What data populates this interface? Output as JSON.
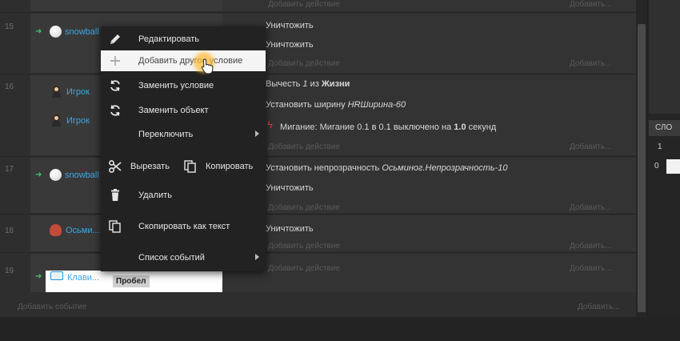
{
  "rows": [
    {
      "num": "15",
      "object": "snowball"
    },
    {
      "num": "16",
      "object": "Игрок",
      "object2": "Игрок"
    },
    {
      "num": "17",
      "object": "snowball"
    },
    {
      "num": "18",
      "object": "Осьми..."
    },
    {
      "num": "19",
      "object": "Клави...",
      "condition_value": "Пробел"
    }
  ],
  "actions": {
    "row15_a": "Уничтожить",
    "row15_b": "Уничтожить",
    "row16_a_pre": "Вычесть ",
    "row16_a_num": "1",
    "row16_a_mid": " из ",
    "row16_a_bold": "Жизни",
    "row16_b_pre": "Установить ширину ",
    "row16_b_val": "HRШирина-60",
    "row16_c_pre": "Мигание: Мигание 0.1 в 0.1 выключено на ",
    "row16_c_bold": "1.0",
    "row16_c_post": " секунд",
    "row17_a_pre": "Установить непрозрачность ",
    "row17_a_val": "Осьминог.Непрозрачность-10",
    "row17_b": "Уничтожить",
    "row18_a": "Уничтожить"
  },
  "add_action_label": "Добавить действие",
  "add_action_right_label": "Добавить...",
  "add_event_label": "Добавить событие",
  "context_menu": {
    "edit": "Редактировать",
    "add_condition": "Добавить другое условие",
    "replace_condition": "Заменить условие",
    "replace_object": "Заменить объект",
    "toggle": "Переключить",
    "cut": "Вырезать",
    "copy": "Копировать",
    "delete": "Удалить",
    "copy_as_text": "Скопировать как текст",
    "event_list": "Список событий"
  },
  "vars_panel": {
    "header": "СЛО",
    "row1": "1",
    "row0": "0"
  },
  "colors": {
    "object_link": "#3fa6e6",
    "arrow": "#3ec46d",
    "highlight": "#f4f4f4",
    "cursor_glow": "#ffbe3c"
  },
  "icons": {
    "edit": "pencil-icon",
    "add": "plus-icon",
    "replace": "refresh-icon",
    "cut": "scissors-icon",
    "copy": "copy-icon",
    "delete": "trash-icon",
    "copy_text": "copy-icon"
  }
}
